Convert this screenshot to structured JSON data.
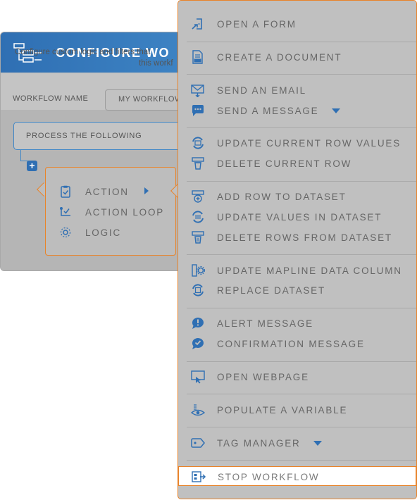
{
  "dialog": {
    "title": "CONFIGURE WO",
    "description_line1": "Configure custom logic and filters that",
    "description_line2": "this workf",
    "workflow_name_label": "WORKFLOW NAME",
    "workflow_name_value": "MY WORKFLOW",
    "process_text": "PROCESS THE FOLLOWING",
    "plus_label": "+"
  },
  "popover": {
    "items": [
      {
        "label": "ACTION",
        "icon": "clipboard-check-icon"
      },
      {
        "label": "ACTION LOOP",
        "icon": "loop-check-icon"
      },
      {
        "label": "LOGIC",
        "icon": "logic-gear-icon"
      }
    ]
  },
  "menu": {
    "items": [
      {
        "label": "OPEN A FORM",
        "icon": "form-icon"
      },
      {
        "label": "CREATE A DOCUMENT",
        "icon": "pdf-document-icon"
      },
      {
        "label": "SEND AN EMAIL",
        "icon": "email-icon"
      },
      {
        "label": "SEND A MESSAGE",
        "icon": "chat-bubble-icon",
        "has_dropdown": true
      },
      {
        "label": "UPDATE CURRENT ROW VALUES",
        "icon": "refresh-row-icon"
      },
      {
        "label": "DELETE CURRENT ROW",
        "icon": "delete-row-icon"
      },
      {
        "label": "ADD ROW TO DATASET",
        "icon": "add-row-icon"
      },
      {
        "label": "UPDATE VALUES IN DATASET",
        "icon": "refresh-dataset-icon"
      },
      {
        "label": "DELETE ROWS FROM DATASET",
        "icon": "delete-rows-icon"
      },
      {
        "label": "UPDATE MAPLINE DATA COLUMN",
        "icon": "data-column-gear-icon"
      },
      {
        "label": "REPLACE DATASET",
        "icon": "replace-dataset-icon"
      },
      {
        "label": "ALERT MESSAGE",
        "icon": "alert-bubble-icon"
      },
      {
        "label": "CONFIRMATION MESSAGE",
        "icon": "confirm-bubble-icon"
      },
      {
        "label": "OPEN WEBPAGE",
        "icon": "monitor-cursor-icon"
      },
      {
        "label": "POPULATE A VARIABLE",
        "icon": "variable-eye-icon"
      },
      {
        "label": "TAG MANAGER",
        "icon": "tag-icon",
        "has_dropdown": true
      },
      {
        "label": "STOP WORKFLOW",
        "icon": "stop-workflow-icon",
        "highlighted": true
      }
    ]
  },
  "colors": {
    "accent_blue": "#2f6fb3",
    "highlight_orange": "#e8832a",
    "overlay_gray": "#c0c0c0"
  }
}
